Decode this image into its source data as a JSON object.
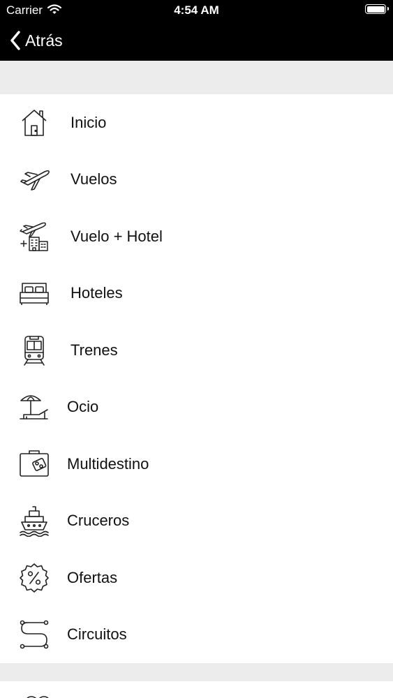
{
  "status_bar": {
    "carrier": "Carrier",
    "time": "4:54 AM",
    "icons": [
      "wifi-icon",
      "battery-icon"
    ]
  },
  "nav": {
    "back_label": "Atrás",
    "back_icon": "chevron-left-icon"
  },
  "menu": {
    "items": [
      {
        "label": "Inicio",
        "icon": "house-icon"
      },
      {
        "label": "Vuelos",
        "icon": "airplane-icon"
      },
      {
        "label": "Vuelo + Hotel",
        "icon": "flight-hotel-icon"
      },
      {
        "label": "Hoteles",
        "icon": "bed-icon"
      },
      {
        "label": "Trenes",
        "icon": "train-icon"
      },
      {
        "label": "Ocio",
        "icon": "beach-umbrella-icon"
      },
      {
        "label": "Multidestino",
        "icon": "suitcase-icon"
      },
      {
        "label": "Cruceros",
        "icon": "ship-icon"
      },
      {
        "label": "Ofertas",
        "icon": "percent-badge-icon"
      },
      {
        "label": "Circuitos",
        "icon": "route-icon"
      }
    ]
  },
  "colors": {
    "bar_background": "#000000",
    "page_background": "#ececec",
    "list_background": "#ffffff",
    "text": "#111111"
  }
}
